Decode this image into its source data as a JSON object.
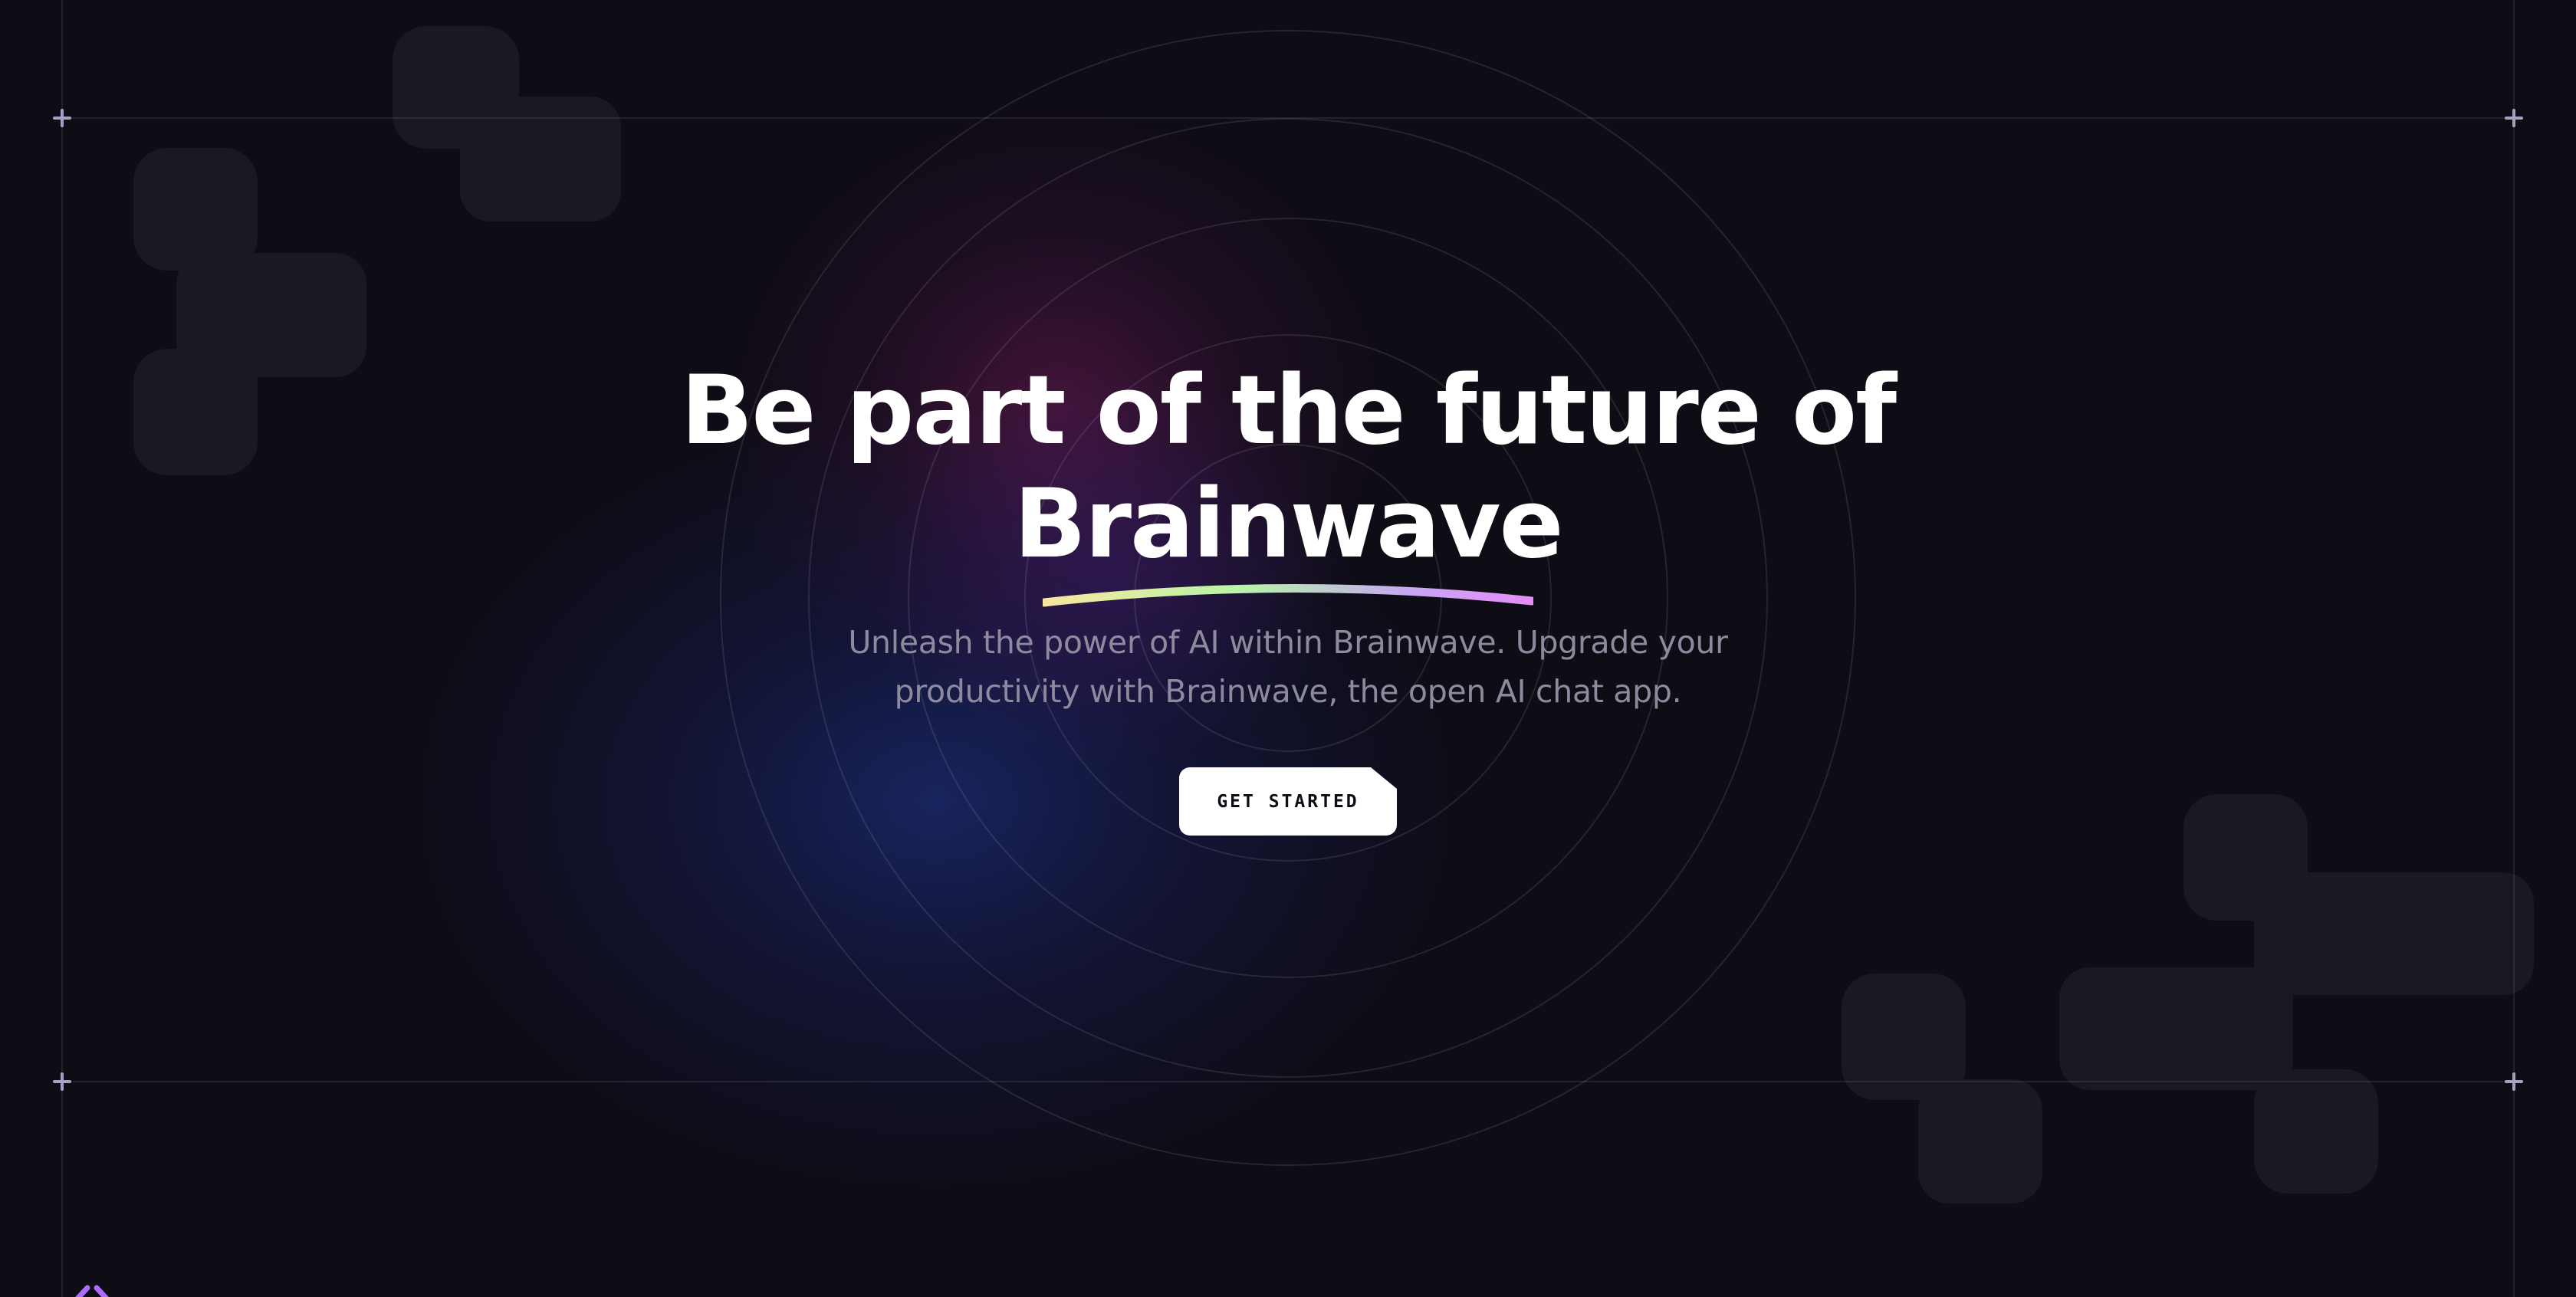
{
  "hero": {
    "title_line_1": "Be part of the future of",
    "title_highlight": "Brainwave",
    "subtitle_line_1": "Unleash the power of AI within Brainwave. Upgrade your",
    "subtitle_line_2": "productivity with Brainwave, the open AI chat app.",
    "cta_label": "GET STARTED"
  },
  "colors": {
    "background": "#0e0c15",
    "heading": "#ffffff",
    "subtitle": "#8e8a9e",
    "button_bg": "#ffffff",
    "button_text": "#0e0c15",
    "underline_gradient": [
      "#f7e6a0",
      "#b8f5a6",
      "#c7a6f5",
      "#e58ef5"
    ],
    "frame_plus": "#a6a1c4"
  },
  "icons": {
    "frame_corners": "plus-icon",
    "brand": "brainwave-logo-icon"
  }
}
